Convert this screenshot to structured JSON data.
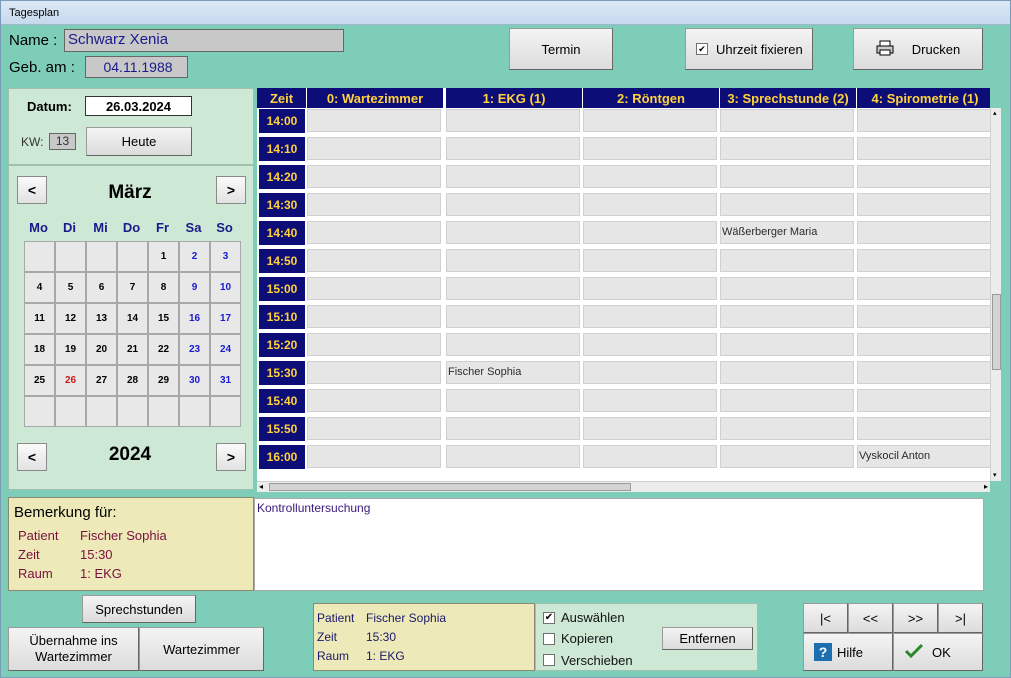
{
  "window": {
    "title": "Tagesplan"
  },
  "patient": {
    "name_label": "Name :",
    "name_value": "Schwarz Xenia",
    "dob_label": "Geb. am :",
    "dob_value": "04.11.1988"
  },
  "toolbar": {
    "termin_label": "Termin",
    "uhrzeit_label": "Uhrzeit fixieren",
    "uhrzeit_checked": "✔",
    "drucken_label": "Drucken"
  },
  "date_panel": {
    "datum_label": "Datum:",
    "datum_value": "26.03.2024",
    "kw_label": "KW:",
    "kw_value": "13",
    "heute_label": "Heute"
  },
  "calendar": {
    "month": "März",
    "year": "2024",
    "prev_symbol": "<",
    "next_symbol": ">",
    "weekdays": [
      "Mo",
      "Di",
      "Mi",
      "Do",
      "Fr",
      "Sa",
      "So"
    ],
    "weeks": [
      [
        "",
        "",
        "",
        "",
        "1",
        "2",
        "3"
      ],
      [
        "4",
        "5",
        "6",
        "7",
        "8",
        "9",
        "10"
      ],
      [
        "11",
        "12",
        "13",
        "14",
        "15",
        "16",
        "17"
      ],
      [
        "18",
        "19",
        "20",
        "21",
        "22",
        "23",
        "24"
      ],
      [
        "25",
        "26",
        "27",
        "28",
        "29",
        "30",
        "31"
      ],
      [
        "",
        "",
        "",
        "",
        "",
        "",
        ""
      ]
    ],
    "highlight_day": "26",
    "weekend_color": "#1a1ad0",
    "highlight_color": "#d01a1a"
  },
  "schedule": {
    "time_header": "Zeit",
    "columns": [
      "0: Wartezimmer",
      "1: EKG (1)",
      "2: Röntgen",
      "3: Sprechstunde (2)",
      "4: Spirometrie (1)"
    ],
    "times": [
      "14:00",
      "14:10",
      "14:20",
      "14:30",
      "14:40",
      "14:50",
      "15:00",
      "15:10",
      "15:20",
      "15:30",
      "15:40",
      "15:50",
      "16:00"
    ],
    "appointments": [
      {
        "time": "14:40",
        "column": 3,
        "name": "Wäßerberger Maria"
      },
      {
        "time": "15:30",
        "column": 1,
        "name": "Fischer Sophia"
      },
      {
        "time": "16:00",
        "column": 4,
        "name": "Vyskocil Anton"
      }
    ],
    "header_bg": "#0d0d78",
    "header_fg": "#ffd23c"
  },
  "remark": {
    "title": "Bemerkung für:",
    "patient_label": "Patient",
    "patient_value": "Fischer Sophia",
    "zeit_label": "Zeit",
    "zeit_value": "15:30",
    "raum_label": "Raum",
    "raum_value": "1: EKG",
    "text": "Kontrolluntersuchung"
  },
  "bottom": {
    "sprechstunden_label": "Sprechstunden",
    "uebernahme_label": "Übernahme ins Wartezimmer",
    "wartezimmer_label": "Wartezimmer",
    "sel_patient_label": "Patient",
    "sel_patient_value": "Fischer Sophia",
    "sel_zeit_label": "Zeit",
    "sel_zeit_value": "15:30",
    "sel_raum_label": "Raum",
    "sel_raum_value": "1: EKG",
    "auswaehlen_label": "Auswählen",
    "kopieren_label": "Kopieren",
    "verschieben_label": "Verschieben",
    "entfernen_label": "Entfernen",
    "nav_first": "|<",
    "nav_prev": "<<",
    "nav_next": ">>",
    "nav_last": ">|",
    "hilfe_label": "Hilfe",
    "ok_label": "OK"
  }
}
